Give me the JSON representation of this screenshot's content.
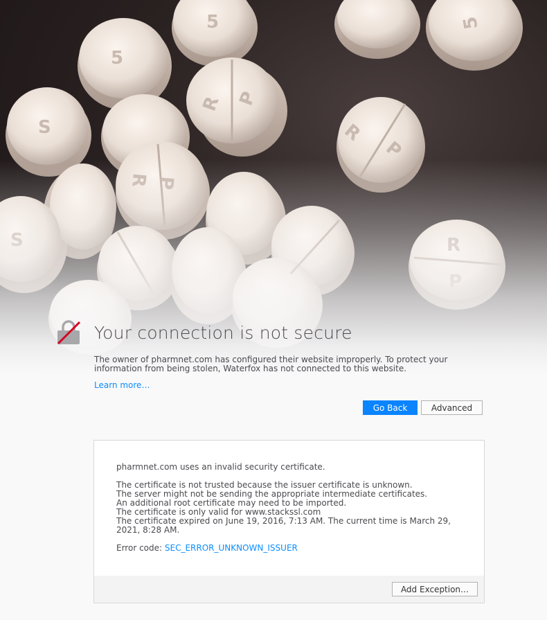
{
  "error_page": {
    "title": "Your connection is not secure",
    "description": "The owner of pharmnet.com has configured their website improperly. To protect your information from being stolen, Waterfox has not connected to this website.",
    "learn_more": "Learn more…",
    "buttons": {
      "go_back": "Go Back",
      "advanced": "Advanced"
    }
  },
  "advanced_panel": {
    "intro": "pharmnet.com uses an invalid security certificate.",
    "details": [
      "The certificate is not trusted because the issuer certificate is unknown.",
      "The server might not be sending the appropriate intermediate certificates.",
      "An additional root certificate may need to be imported.",
      "The certificate is only valid for www.stackssl.com",
      "The certificate expired on June 19, 2016, 7:13 AM. The current time is March 29, 2021, 8:28 AM."
    ],
    "error_code_label": "Error code: ",
    "error_code": "SEC_ERROR_UNKNOWN_ISSUER",
    "add_exception": "Add Exception…"
  },
  "icons": {
    "lock": "broken-lock-icon"
  },
  "colors": {
    "accent": "#0a84ff",
    "link": "#0a8dff",
    "lock_slash": "#d70022"
  }
}
